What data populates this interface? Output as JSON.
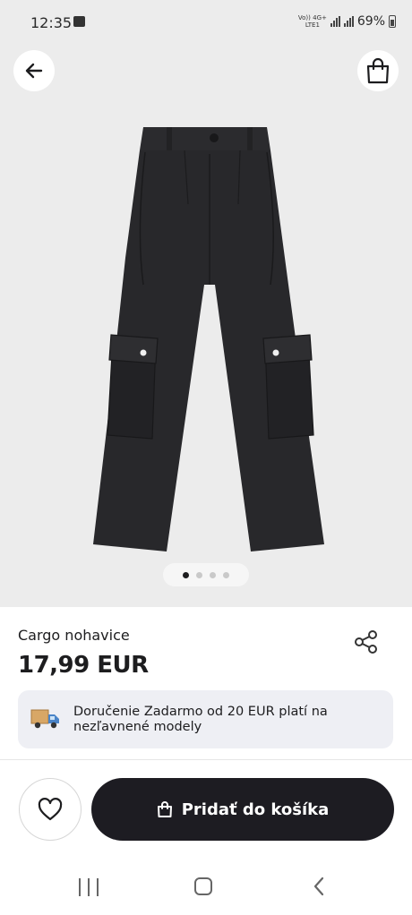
{
  "status_bar": {
    "time": "12:35",
    "network_line1": "Vo)) 4G+",
    "network_line2": "LTE1",
    "battery": "69%"
  },
  "product": {
    "name": "Cargo nohavice",
    "price": "17,99 EUR",
    "image_count": 4,
    "active_image": 1
  },
  "delivery": {
    "icon": "delivery-truck-icon",
    "text": "Doručenie Zadarmo od 20 EUR platí na nezľavnené modely"
  },
  "actions": {
    "add_to_cart_label": "Pridať do košíka"
  },
  "colors": {
    "accent": "#1d1c22",
    "hero_background": "#ececec",
    "delivery_background": "#eeeff4"
  },
  "icons": {
    "back": "arrow-left-icon",
    "bag": "shopping-bag-icon",
    "share": "share-icon",
    "favorite": "heart-icon"
  }
}
